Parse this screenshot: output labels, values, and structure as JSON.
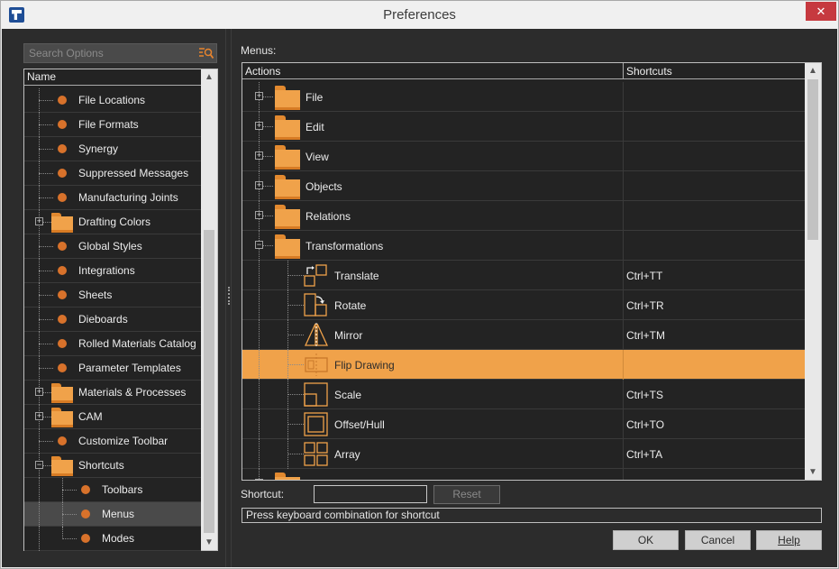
{
  "window": {
    "title": "Preferences",
    "close_glyph": "✕",
    "icon": "app-logo-icon"
  },
  "left": {
    "search_placeholder": "Search Options",
    "tree_header": "Name",
    "items": [
      {
        "label": "File Locations",
        "type": "leaf"
      },
      {
        "label": "File Formats",
        "type": "leaf"
      },
      {
        "label": "Synergy",
        "type": "leaf"
      },
      {
        "label": "Suppressed Messages",
        "type": "leaf"
      },
      {
        "label": "Manufacturing Joints",
        "type": "leaf"
      },
      {
        "label": "Drafting Colors",
        "type": "folder",
        "expander": "+"
      },
      {
        "label": "Global Styles",
        "type": "leaf"
      },
      {
        "label": "Integrations",
        "type": "leaf"
      },
      {
        "label": "Sheets",
        "type": "leaf"
      },
      {
        "label": "Dieboards",
        "type": "leaf"
      },
      {
        "label": "Rolled Materials Catalog",
        "type": "leaf"
      },
      {
        "label": "Parameter Templates",
        "type": "leaf"
      },
      {
        "label": "Materials & Processes",
        "type": "folder",
        "expander": "+"
      },
      {
        "label": "CAM",
        "type": "folder",
        "expander": "+"
      },
      {
        "label": "Customize Toolbar",
        "type": "leaf"
      },
      {
        "label": "Shortcuts",
        "type": "folder",
        "expander": "−"
      },
      {
        "label": "Toolbars",
        "type": "child"
      },
      {
        "label": "Menus",
        "type": "child",
        "selected": true
      },
      {
        "label": "Modes",
        "type": "child"
      }
    ]
  },
  "right": {
    "menus_label": "Menus:",
    "col_actions": "Actions",
    "col_shortcuts": "Shortcuts",
    "rows": [
      {
        "label": "File",
        "type": "folder",
        "expander": "+",
        "shortcut": ""
      },
      {
        "label": "Edit",
        "type": "folder",
        "expander": "+",
        "shortcut": ""
      },
      {
        "label": "View",
        "type": "folder",
        "expander": "+",
        "shortcut": ""
      },
      {
        "label": "Objects",
        "type": "folder",
        "expander": "+",
        "shortcut": ""
      },
      {
        "label": "Relations",
        "type": "folder",
        "expander": "+",
        "shortcut": ""
      },
      {
        "label": "Transformations",
        "type": "folder",
        "expander": "−",
        "shortcut": ""
      },
      {
        "label": "Translate",
        "type": "child",
        "icon": "translate-icon",
        "shortcut": "Ctrl+TT"
      },
      {
        "label": "Rotate",
        "type": "child",
        "icon": "rotate-icon",
        "shortcut": "Ctrl+TR"
      },
      {
        "label": "Mirror",
        "type": "child",
        "icon": "mirror-icon",
        "shortcut": "Ctrl+TM"
      },
      {
        "label": "Flip Drawing",
        "type": "child",
        "icon": "flip-drawing-icon",
        "shortcut": "",
        "selected": true
      },
      {
        "label": "Scale",
        "type": "child",
        "icon": "scale-icon",
        "shortcut": "Ctrl+TS"
      },
      {
        "label": "Offset/Hull",
        "type": "child",
        "icon": "offset-hull-icon",
        "shortcut": "Ctrl+TO"
      },
      {
        "label": "Array",
        "type": "child",
        "icon": "array-icon",
        "shortcut": "Ctrl+TA"
      },
      {
        "label": "",
        "type": "folder",
        "expander": "+",
        "shortcut": ""
      }
    ],
    "shortcut_label": "Shortcut:",
    "shortcut_value": "",
    "reset_label": "Reset",
    "hint": "Press keyboard combination for shortcut"
  },
  "buttons": {
    "ok": "OK",
    "cancel": "Cancel",
    "help": "Help"
  },
  "colors": {
    "accent": "#f0a24a",
    "panel": "#2c2c2c",
    "tree_bg": "#232323",
    "dot": "#d8722b"
  }
}
